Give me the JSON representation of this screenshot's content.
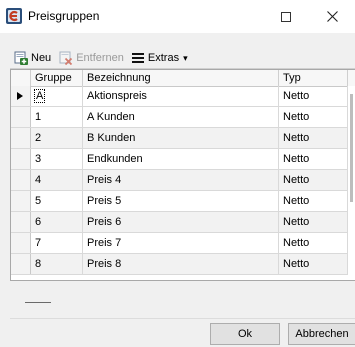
{
  "window": {
    "title": "Preisgruppen"
  },
  "toolbar": {
    "new_label": "Neu",
    "remove_label": "Entfernen",
    "extras_label": "Extras",
    "extras_arrow": "▾"
  },
  "grid": {
    "columns": [
      "Gruppe",
      "Bezeichnung",
      "Typ"
    ],
    "rows": [
      {
        "gruppe": "A",
        "bezeichnung": "Aktionspreis",
        "typ": "Netto"
      },
      {
        "gruppe": "1",
        "bezeichnung": "A Kunden",
        "typ": "Netto"
      },
      {
        "gruppe": "2",
        "bezeichnung": "B Kunden",
        "typ": "Netto"
      },
      {
        "gruppe": "3",
        "bezeichnung": "Endkunden",
        "typ": "Netto"
      },
      {
        "gruppe": "4",
        "bezeichnung": "Preis 4",
        "typ": "Netto"
      },
      {
        "gruppe": "5",
        "bezeichnung": "Preis 5",
        "typ": "Netto"
      },
      {
        "gruppe": "6",
        "bezeichnung": "Preis 6",
        "typ": "Netto"
      },
      {
        "gruppe": "7",
        "bezeichnung": "Preis 7",
        "typ": "Netto"
      },
      {
        "gruppe": "8",
        "bezeichnung": "Preis 8",
        "typ": "Netto"
      }
    ]
  },
  "buttons": {
    "ok": "Ok",
    "cancel": "Abbrechen"
  },
  "icons": {
    "app": "app-icon",
    "new": "add-document-icon",
    "remove": "delete-document-icon",
    "extras": "hamburger-menu-icon",
    "maximize": "maximize-icon",
    "close": "close-icon",
    "row_indicator": "current-row-arrow-icon"
  },
  "colors": {
    "accent": "#2f7d32",
    "remove": "#c23b22",
    "app_icon": "#2a4e7a"
  }
}
